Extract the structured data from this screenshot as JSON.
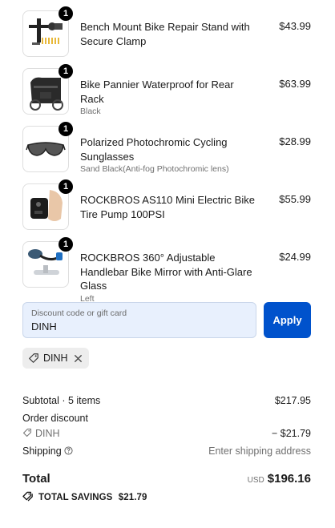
{
  "line_items": [
    {
      "title": "Bench Mount Bike Repair Stand with Secure Clamp",
      "variant": "",
      "price": "$43.99",
      "quantity": "1",
      "image": "repair-stand-image"
    },
    {
      "title": "Bike Pannier Waterproof for Rear Rack",
      "variant": "Black",
      "price": "$63.99",
      "quantity": "1",
      "image": "pannier-bag-image"
    },
    {
      "title": "Polarized Photochromic Cycling Sunglasses",
      "variant": "Sand Black(Anti-fog Photochromic lens)",
      "price": "$28.99",
      "quantity": "1",
      "image": "sunglasses-image"
    },
    {
      "title": "ROCKBROS AS110 Mini Electric Bike Tire Pump 100PSI",
      "variant": "",
      "price": "$55.99",
      "quantity": "1",
      "image": "tire-pump-image"
    },
    {
      "title": "ROCKBROS 360° Adjustable Handlebar Bike Mirror with Anti-Glare Glass",
      "variant": "Left",
      "price": "$24.99",
      "quantity": "1",
      "image": "bike-mirror-image"
    }
  ],
  "discount": {
    "placeholder": "Discount code or gift card",
    "value": "DINH",
    "apply_label": "Apply",
    "applied_code": "DINH"
  },
  "summary": {
    "subtotal_label": "Subtotal · 5 items",
    "subtotal_value": "$217.95",
    "order_discount_label": "Order discount",
    "discount_code": "DINH",
    "discount_value": "− $21.79",
    "shipping_label": "Shipping",
    "shipping_value": "Enter shipping address",
    "total_label": "Total",
    "currency": "USD",
    "total_value": "$196.16",
    "savings_label": "TOTAL SAVINGS",
    "savings_value": "$21.79"
  },
  "colors": {
    "accent": "#0052cc",
    "input_bg": "#e8f0fd",
    "chip_bg": "#ededed"
  }
}
